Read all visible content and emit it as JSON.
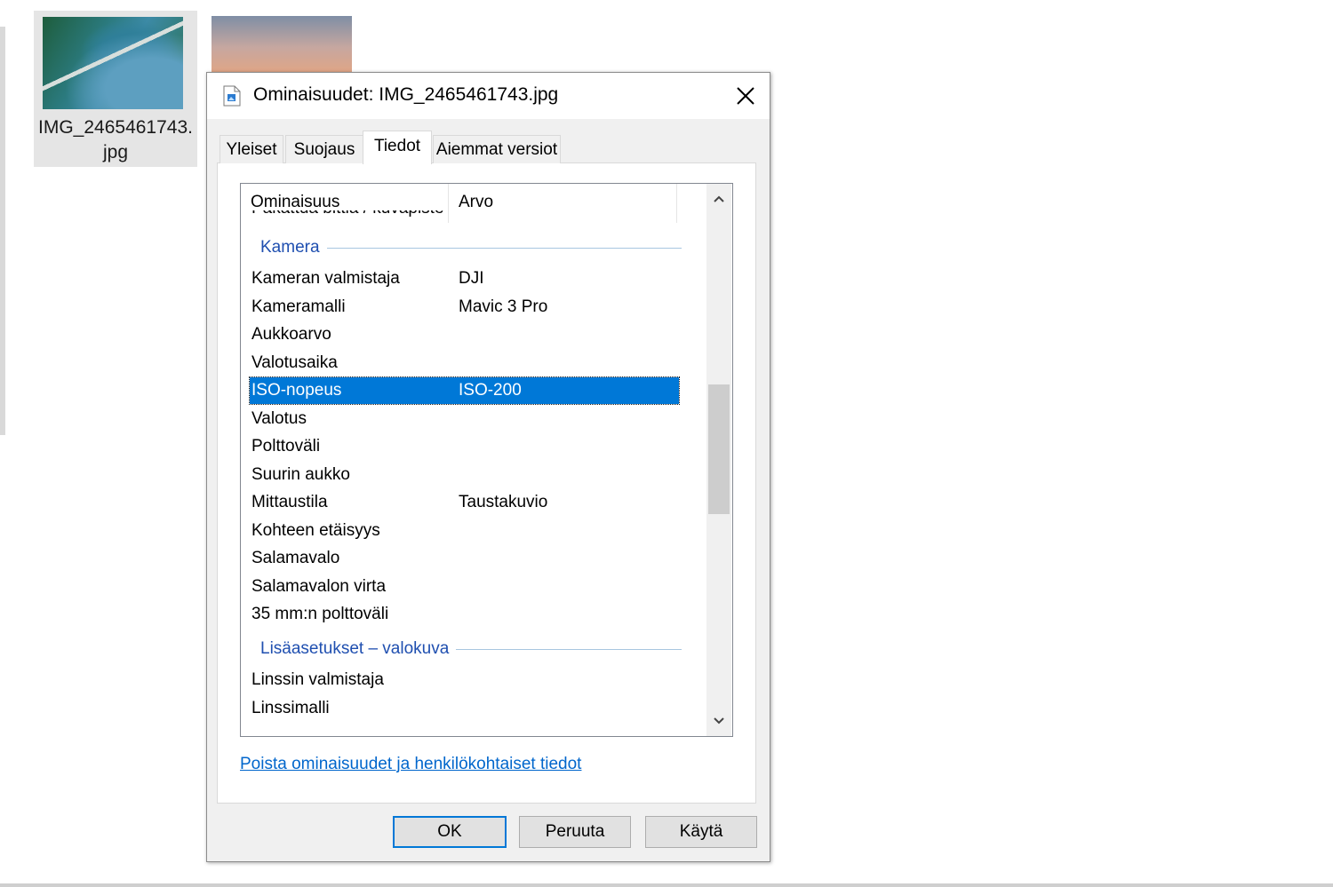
{
  "desktop": {
    "files": [
      {
        "name_line1": "IMG_2465461743.",
        "name_line2": "jpg"
      }
    ]
  },
  "dialog": {
    "title": "Ominaisuudet: IMG_2465461743.jpg",
    "tabs": [
      {
        "label": "Yleiset"
      },
      {
        "label": "Suojaus"
      },
      {
        "label": "Tiedot",
        "active": true
      },
      {
        "label": "Aiemmat versiot"
      }
    ],
    "list": {
      "columns": {
        "property": "Ominaisuus",
        "value": "Arvo"
      },
      "partial_row": {
        "property": "Pakattua bittiä / kuvapiste"
      },
      "groups": [
        {
          "label": "Kamera",
          "rows": [
            {
              "property": "Kameran valmistaja",
              "value": "DJI"
            },
            {
              "property": "Kameramalli",
              "value": "Mavic 3 Pro"
            },
            {
              "property": "Aukkoarvo",
              "value": ""
            },
            {
              "property": "Valotusaika",
              "value": ""
            },
            {
              "property": "ISO-nopeus",
              "value": "ISO-200",
              "selected": true
            },
            {
              "property": "Valotus",
              "value": ""
            },
            {
              "property": "Polttoväli",
              "value": ""
            },
            {
              "property": "Suurin aukko",
              "value": ""
            },
            {
              "property": "Mittaustila",
              "value": "Taustakuvio"
            },
            {
              "property": "Kohteen etäisyys",
              "value": ""
            },
            {
              "property": "Salamavalo",
              "value": ""
            },
            {
              "property": "Salamavalon virta",
              "value": ""
            },
            {
              "property": "35 mm:n polttoväli",
              "value": ""
            }
          ]
        },
        {
          "label": "Lisäasetukset – valokuva",
          "rows": [
            {
              "property": "Linssin valmistaja",
              "value": ""
            },
            {
              "property": "Linssimalli",
              "value": ""
            }
          ]
        }
      ]
    },
    "remove_link": "Poista ominaisuudet ja henkilökohtaiset tiedot",
    "buttons": {
      "ok": "OK",
      "cancel": "Peruuta",
      "apply": "Käytä"
    }
  },
  "colors": {
    "selection": "#0078d7",
    "group_header": "#1f4fb0",
    "link": "#0066cc",
    "dialog_bg": "#f0f0f0"
  },
  "icons": {
    "file": "image-file-icon",
    "close": "close-icon",
    "scroll_up": "chevron-up-icon",
    "scroll_down": "chevron-down-icon"
  }
}
